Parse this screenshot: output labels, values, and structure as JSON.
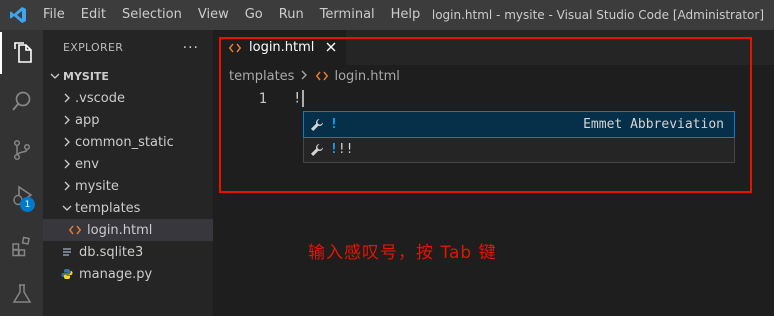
{
  "titlebar": {
    "menu": [
      "File",
      "Edit",
      "Selection",
      "View",
      "Go",
      "Run",
      "Terminal",
      "Help"
    ],
    "window_title": "login.html - mysite - Visual Studio Code [Administrator]"
  },
  "activitybar": {
    "items": [
      "files-icon",
      "search-icon",
      "source-control-icon",
      "run-debug-icon",
      "extensions-icon",
      "testing-icon"
    ],
    "debug_badge": "1"
  },
  "explorer": {
    "header": "EXPLORER",
    "more": "···",
    "root": "MYSITE",
    "items": [
      {
        "label": ".vscode",
        "type": "folder"
      },
      {
        "label": "app",
        "type": "folder"
      },
      {
        "label": "common_static",
        "type": "folder"
      },
      {
        "label": "env",
        "type": "folder"
      },
      {
        "label": "mysite",
        "type": "folder"
      },
      {
        "label": "templates",
        "type": "folder-open"
      },
      {
        "label": "login.html",
        "type": "html-file"
      },
      {
        "label": "db.sqlite3",
        "type": "file"
      },
      {
        "label": "manage.py",
        "type": "python-file"
      }
    ]
  },
  "editor": {
    "tab_label": "login.html",
    "breadcrumb": [
      "templates",
      "login.html"
    ],
    "line_number": "1",
    "code": "!",
    "suggestions": [
      {
        "match": "!",
        "rest": "",
        "detail": "Emmet Abbreviation"
      },
      {
        "match": "!",
        "rest": "!!",
        "detail": ""
      }
    ]
  },
  "annotation": {
    "text": "输入感叹号，按 Tab 键",
    "color": "#e51400"
  },
  "colors": {
    "accent": "#007acc",
    "html_icon": "#e37933",
    "python_icon": "#3572a5"
  }
}
